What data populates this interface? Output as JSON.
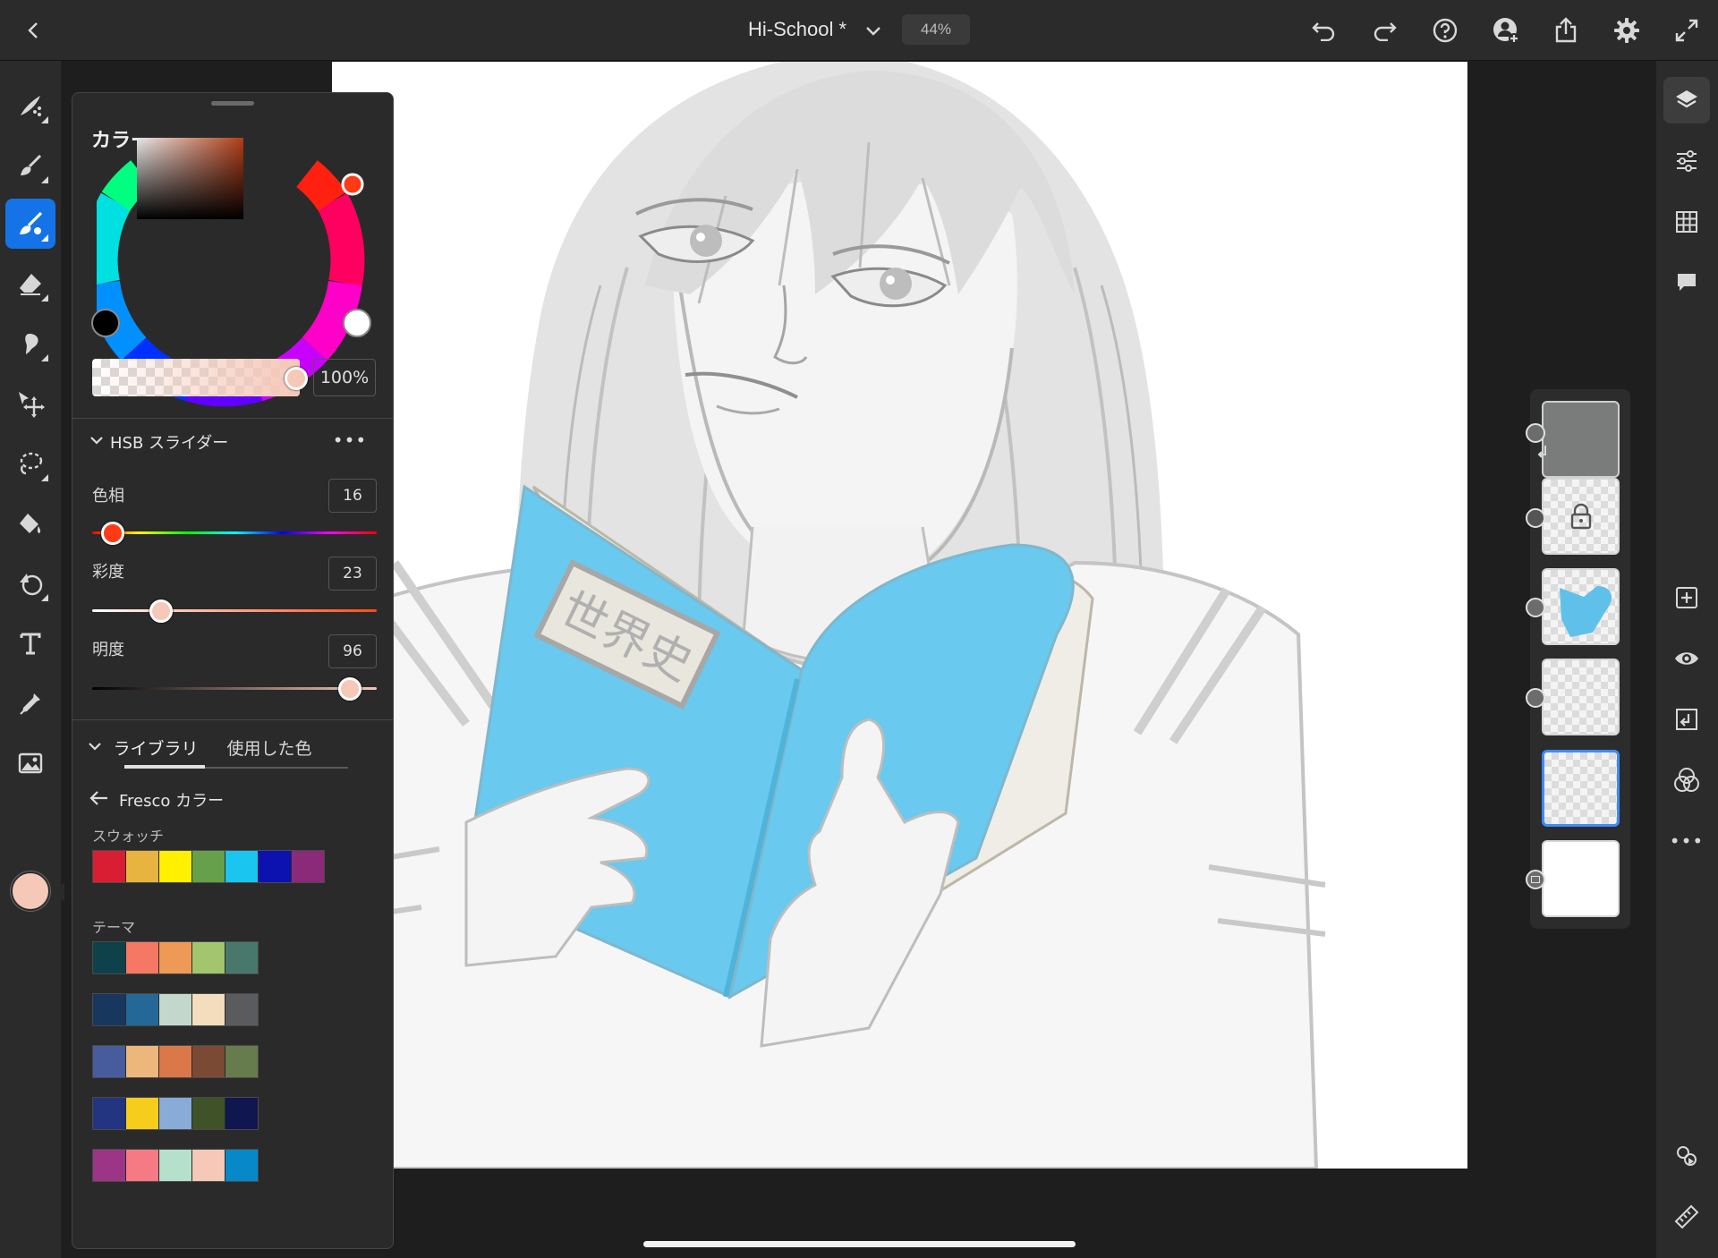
{
  "header": {
    "title": "Hi-School *",
    "zoom": "44%"
  },
  "color_panel": {
    "title": "カラー",
    "opacity": "100%",
    "hsb_section": "HSB スライダー",
    "more": "•••",
    "hue": {
      "label": "色相",
      "value": "16"
    },
    "saturation": {
      "label": "彩度",
      "value": "23"
    },
    "brightness": {
      "label": "明度",
      "value": "96"
    },
    "tabs": [
      "ライブラリ",
      "使用した色"
    ],
    "library_name": "Fresco カラー",
    "swatches_heading": "スウォッチ",
    "swatches": [
      "#d91d32",
      "#e7b43f",
      "#fff000",
      "#66a04a",
      "#1ac5ef",
      "#0b12b0",
      "#8b2a79"
    ],
    "themes_heading": "テーマ",
    "themes": [
      [
        "#0f414b",
        "#f57864",
        "#ee9a56",
        "#a2c56d",
        "#48786c"
      ],
      [
        "#17375f",
        "#236896",
        "#c4d7cc",
        "#f3ddbd",
        "#5a5b5e"
      ],
      [
        "#475c9c",
        "#edb77c",
        "#db7849",
        "#7a4a34",
        "#667c4d"
      ],
      [
        "#233580",
        "#f7cd1d",
        "#88abd8",
        "#3f5228",
        "#10164f"
      ],
      [
        "#9c3585",
        "#f57a84",
        "#b5e0cc",
        "#f5c8b8",
        "#0688c9"
      ]
    ]
  },
  "canvas": {
    "book_label": "世界史"
  },
  "current_color": "#f5c8b8",
  "accent_color": "#1473e6"
}
